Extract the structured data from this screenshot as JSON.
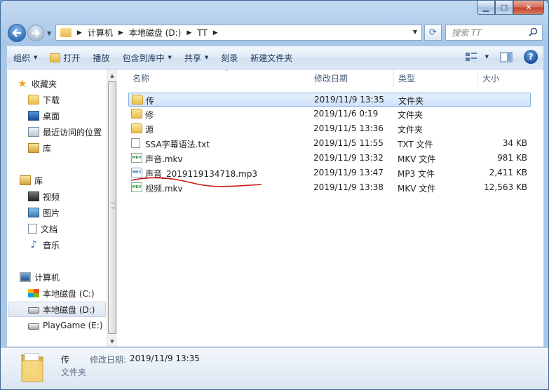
{
  "window": {
    "caption": {
      "minimize": "▁",
      "maximize": "□",
      "close": "✕"
    }
  },
  "address": {
    "crumbs": [
      "计算机",
      "本地磁盘 (D:)",
      "TT"
    ],
    "search_placeholder": "搜索 TT"
  },
  "toolbar": {
    "organize": "组织",
    "open": "打开",
    "play": "播放",
    "include": "包含到库中",
    "share": "共享",
    "burn": "刻录",
    "new_folder": "新建文件夹",
    "help": "?"
  },
  "sidebar": {
    "favorites": {
      "label": "收藏夹",
      "items": [
        "下载",
        "桌面",
        "最近访问的位置",
        "库"
      ]
    },
    "libraries": {
      "label": "库",
      "items": [
        "视频",
        "图片",
        "文档",
        "音乐"
      ]
    },
    "computer": {
      "label": "计算机",
      "items": [
        "本地磁盘 (C:)",
        "本地磁盘 (D:)",
        "PlayGame (E:)"
      ]
    }
  },
  "columns": {
    "name": "名称",
    "date": "修改日期",
    "type": "类型",
    "size": "大小"
  },
  "files": [
    {
      "name": "传",
      "date": "2019/11/9 13:35",
      "type": "文件夹",
      "size": "",
      "icon": "folder"
    },
    {
      "name": "修",
      "date": "2019/11/6 0:19",
      "type": "文件夹",
      "size": "",
      "icon": "folder"
    },
    {
      "name": "源",
      "date": "2019/11/5 13:36",
      "type": "文件夹",
      "size": "",
      "icon": "folder"
    },
    {
      "name": "SSA字幕语法.txt",
      "date": "2019/11/5 11:55",
      "type": "TXT 文件",
      "size": "34 KB",
      "icon": "txt-file"
    },
    {
      "name": "声音.mkv",
      "date": "2019/11/9 13:32",
      "type": "MKV 文件",
      "size": "981 KB",
      "icon": "mkv-file"
    },
    {
      "name": "声音_2019119134718.mp3",
      "date": "2019/11/9 13:47",
      "type": "MP3 文件",
      "size": "2,411 KB",
      "icon": "mp3-file"
    },
    {
      "name": "视频.mkv",
      "date": "2019/11/9 13:38",
      "type": "MKV 文件",
      "size": "12,563 KB",
      "icon": "mkv-file"
    }
  ],
  "file_badges": {
    "mkv": "MKV",
    "mp3": "MP3"
  },
  "details": {
    "name": "传",
    "type": "文件夹",
    "modified_label": "修改日期:",
    "modified_value": "2019/11/9 13:35"
  },
  "colors": {
    "annotation_underline": "#d01818",
    "selection": "#cfe3fa"
  }
}
